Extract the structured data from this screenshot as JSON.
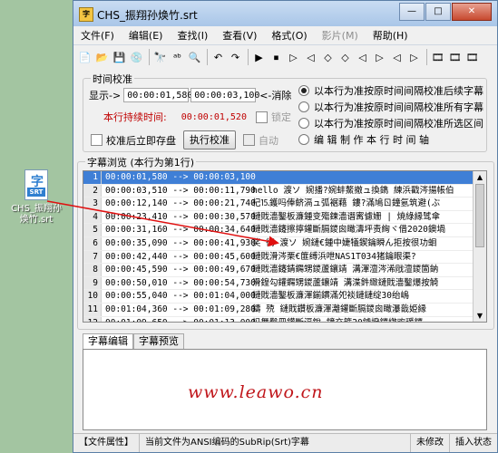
{
  "desktop": {
    "icon_tab": "SRT",
    "icon_label_line1": "CHS_振翔孙",
    "icon_label_line2": "焕竹.srt"
  },
  "window": {
    "app_icon": "字",
    "title": "CHS_振翔孙焕竹.srt",
    "minimize": "—",
    "maximize": "□",
    "close": "✕"
  },
  "menu": [
    "文件(F)",
    "编辑(E)",
    "查找(I)",
    "查看(V)",
    "格式(O)",
    "影片(M)",
    "帮助(H)"
  ],
  "toolbar": [
    "📄",
    "📂",
    "💾",
    "💿",
    "🔭",
    "ᵃᵇ",
    "🔍",
    "↶",
    "↷",
    "▶",
    "⏹",
    "▷",
    "◁",
    "◇",
    "◇",
    "◁",
    "▷",
    "◁",
    "▷",
    "🎞",
    "🎞",
    "🎞"
  ],
  "timing": {
    "group_title": "时间校准",
    "display_label": "显示->",
    "start_time": "00:00:01,580",
    "end_time": "00:00:03,100",
    "cancel_link": "<-消除",
    "duration_label": "本行持续时间:",
    "duration_value": "00:00:01,520",
    "lock_label": "锁定",
    "save_after_label": "校准后立即存盘",
    "run_button": "执行校准",
    "auto_label": "自动",
    "radio_options": [
      "以本行为准按原时间间隔校准后续字幕",
      "以本行为准按原时间间隔校准所有字幕",
      "以本行为准按原时间间隔校准所选区间",
      "编 辑 制 作 本 行 时 间 轴"
    ]
  },
  "browser": {
    "group_title": "字幕浏览 (本行为第1行)",
    "rows": [
      {
        "idx": "1",
        "time": "00:00:01,580 --> 00:00:03,100",
        "text": ""
      },
      {
        "idx": "2",
        "time": "00:00:03,510 --> 00:00:11,790",
        "text": "hello 渡ソ 婉播?婉蚌鰲撤ュ換鐫  練浜戳涔揚帳伯"
      },
      {
        "idx": "3",
        "time": "00:00:12,140 --> 00:00:21,740",
        "text": "杞⒖鑊吗俸鲚滆ュ弧裾藉   鏤?滿鳩ㄖ鐘氬筑避(ぶ"
      },
      {
        "idx": "4",
        "time": "00:00:23,410 --> 00:00:30,570",
        "text": "鏈戝濇鑿板濂鍾变殤鍊濇谮寗儢姗 | 焼綠縁骘傘"
      },
      {
        "idx": "5",
        "time": "00:00:31,160 --> 00:00:34,640",
        "text": "鏈戝濇鑳擦擰鑵斷膈鑁囪瞰濤坪责絢ヾ借2020鐭堝"
      },
      {
        "idx": "6",
        "time": "00:00:35,090 --> 00:00:41,930",
        "text": "奖  彻  渡ソ 婉鏈€鍾中婕犠鍥鑰瞬ん拒按很功蛔"
      },
      {
        "idx": "7",
        "time": "00:00:42,440 --> 00:00:45,600",
        "text": "鏈戝滑涔栗€篚缚浜呭NAS1T034猪鑰眼渠?"
      },
      {
        "idx": "8",
        "time": "00:00:45,590 --> 00:00:49,670",
        "text": "鏈戝濇鑳錆鐊甥鑁蘆鑲靖   溝渾澶涔浠戙澶鑁箇鈉"
      },
      {
        "idx": "9",
        "time": "00:00:50,010 --> 00:00:54,730",
        "text": "滑鍠勾鑵鐊甥鑁蘆鑲靖   溝渫鈝緻鏈戝濇鑿爆按觭"
      },
      {
        "idx": "10",
        "time": "00:00:55,040 --> 00:01:04,000",
        "text": "鏈戝濇鑿板濂渾鎆鏆滿夗裧鏈鏈绽30绐嶋"
      },
      {
        "idx": "11",
        "time": "00:01:04,360 --> 00:01:09,280",
        "text": "鑄   殑 鏈戝鑽板濂渾灕鑵斷膈鑁囪瞰瀑戠姫縁"
      },
      {
        "idx": "12",
        "time": "00:01:09,650 --> 00:01:13,000",
        "text": "杩舞鑿冊鑵斷滆銳   鐘充箍20鐪撥鑁繺欢瑗鑁"
      }
    ]
  },
  "editor": {
    "tab_edit": "字幕编辑",
    "tab_preview": "字幕预览",
    "watermark": "www.leawo.cn"
  },
  "status": {
    "file_props": "【文件属性】",
    "file_info": "当前文件为ANSI编码的SubRip(Srt)字幕",
    "modified": "未修改",
    "insert_state": "插入状态"
  }
}
